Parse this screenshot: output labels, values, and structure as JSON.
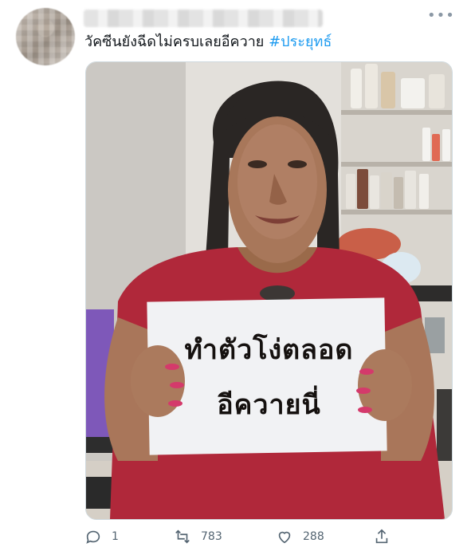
{
  "tweet": {
    "text": "วัคซีนยังฉีดไม่ครบเลยอีควาย",
    "hashtag": "#ประยุทธ์",
    "more_icon": "more-horizontal-icon"
  },
  "media": {
    "sign_line1": "ทำตัวโง่ตลอด",
    "sign_line2": "อีควายนี่"
  },
  "actions": {
    "reply_count": "1",
    "retweet_count": "783",
    "like_count": "288"
  },
  "colors": {
    "accent": "#1d9bf0",
    "muted": "#536471"
  }
}
